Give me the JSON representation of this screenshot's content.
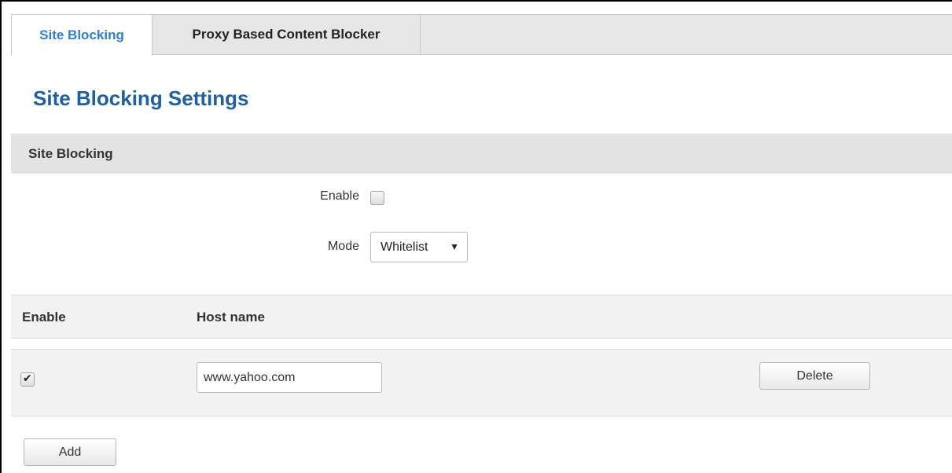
{
  "tabs": {
    "active": "Site Blocking",
    "inactive": "Proxy Based Content Blocker"
  },
  "page_title": "Site Blocking Settings",
  "section": {
    "title": "Site Blocking",
    "enable_label": "Enable",
    "enable_checked": false,
    "mode_label": "Mode",
    "mode_value": "Whitelist"
  },
  "table": {
    "headers": [
      "Enable",
      "Host name"
    ],
    "rows": [
      {
        "enabled": true,
        "host": "www.yahoo.com",
        "delete_label": "Delete"
      }
    ]
  },
  "add_label": "Add",
  "icons": {
    "dropdown": "caret-down-icon",
    "check": "checkmark-icon"
  }
}
